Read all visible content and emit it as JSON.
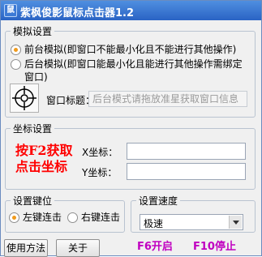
{
  "window": {
    "title": "紫枫俊影鼠标点击器1.2",
    "icon_text": "鼠"
  },
  "sim_group": {
    "title": "模拟设置",
    "options": [
      {
        "label_line1": "前台模拟(即窗口不能最小化且不能进行其他操作)",
        "label_line2": "",
        "checked": true
      },
      {
        "label_line1": "后台模拟(即窗口能最小化且能进行其他操作需绑定",
        "label_line2": "窗口)",
        "checked": false
      }
    ],
    "window_title_label": "窗口标题：",
    "window_title_placeholder": "后台模式请拖放准星获取窗口信息"
  },
  "coord_group": {
    "title": "坐标设置",
    "hint_line1": "按F2获取",
    "hint_line2": "点击坐标",
    "x_label": "X坐标：",
    "y_label": "Y坐标：",
    "x_value": "",
    "y_value": ""
  },
  "key_group": {
    "title": "设置键位",
    "left_label": "左键连击",
    "right_label": "右键连击",
    "left_checked": true
  },
  "speed_group": {
    "title": "设置速度",
    "selected": "极速"
  },
  "buttons": {
    "usage": "使用方法",
    "about": "关于"
  },
  "hotkeys": {
    "start": "F6开启",
    "stop": "F10停止"
  }
}
